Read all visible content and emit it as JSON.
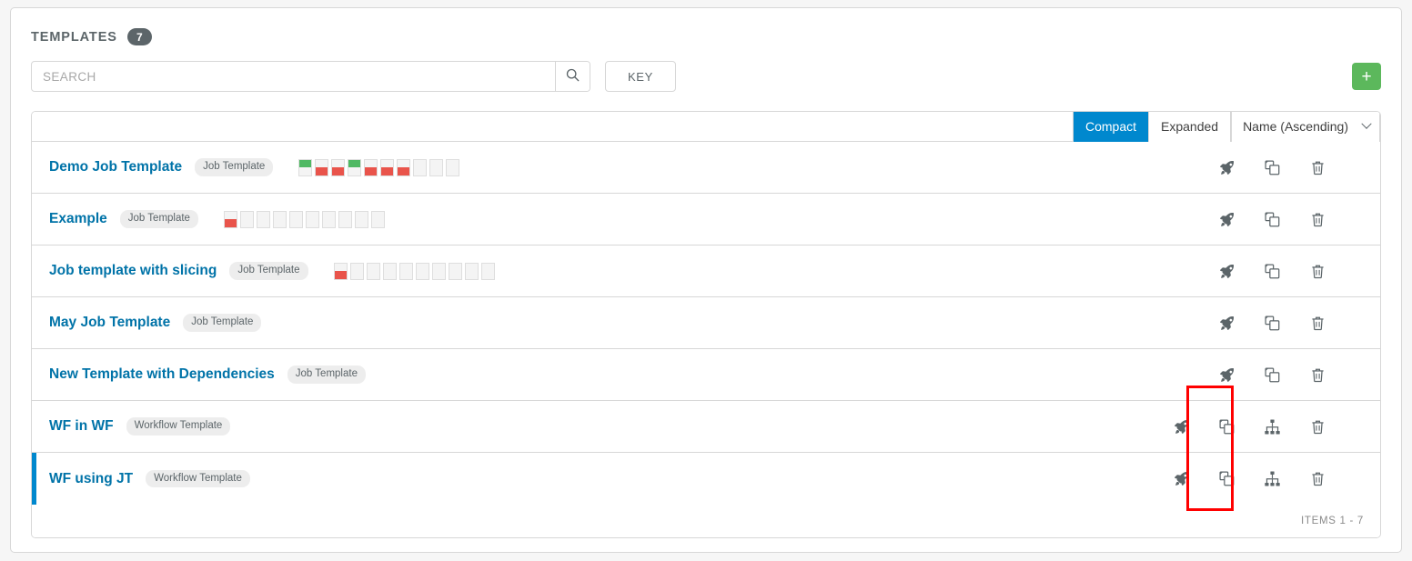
{
  "panel": {
    "title": "TEMPLATES",
    "count": "7"
  },
  "search": {
    "placeholder": "SEARCH",
    "value": "",
    "search_icon": "search-icon",
    "key_label": "KEY"
  },
  "add_button": {
    "label": "+",
    "color": "#5cb85c"
  },
  "toolbar": {
    "view_modes": [
      {
        "label": "Compact",
        "active": true
      },
      {
        "label": "Expanded",
        "active": false
      }
    ],
    "sort": {
      "selected": "Name (Ascending)",
      "chevron_icon": "chevron-down-icon"
    }
  },
  "colors": {
    "link": "#0073a8",
    "accent": "#0088ce",
    "success": "#4fb963",
    "danger": "#e9544b",
    "badge_bg": "#ededed",
    "count_badge_bg": "#5c6569",
    "annotation": "#ff0000"
  },
  "rows": [
    {
      "name": "Demo Job Template",
      "type": "Job Template",
      "selected": false,
      "statuses": [
        "ok",
        "err",
        "err",
        "ok",
        "err",
        "err",
        "err",
        "none",
        "none",
        "none"
      ],
      "actions": [
        "rocket-icon",
        "copy-icon",
        "trash-icon"
      ]
    },
    {
      "name": "Example",
      "type": "Job Template",
      "selected": false,
      "statuses": [
        "err",
        "none",
        "none",
        "none",
        "none",
        "none",
        "none",
        "none",
        "none",
        "none"
      ],
      "actions": [
        "rocket-icon",
        "copy-icon",
        "trash-icon"
      ]
    },
    {
      "name": "Job template with slicing",
      "type": "Job Template",
      "selected": false,
      "statuses": [
        "err",
        "none",
        "none",
        "none",
        "none",
        "none",
        "none",
        "none",
        "none",
        "none"
      ],
      "actions": [
        "rocket-icon",
        "copy-icon",
        "trash-icon"
      ]
    },
    {
      "name": "May Job Template",
      "type": "Job Template",
      "selected": false,
      "statuses": [],
      "actions": [
        "rocket-icon",
        "copy-icon",
        "trash-icon"
      ]
    },
    {
      "name": "New Template with Dependencies",
      "type": "Job Template",
      "selected": false,
      "statuses": [],
      "actions": [
        "rocket-icon",
        "copy-icon",
        "trash-icon"
      ]
    },
    {
      "name": "WF in WF",
      "type": "Workflow Template",
      "selected": false,
      "statuses": [],
      "actions": [
        "rocket-icon",
        "copy-icon",
        "sitemap-icon",
        "trash-icon"
      ]
    },
    {
      "name": "WF using JT",
      "type": "Workflow Template",
      "selected": true,
      "statuses": [],
      "actions": [
        "rocket-icon",
        "copy-icon",
        "sitemap-icon",
        "trash-icon"
      ]
    }
  ],
  "footer": {
    "items_label": "ITEMS  1 - 7"
  }
}
